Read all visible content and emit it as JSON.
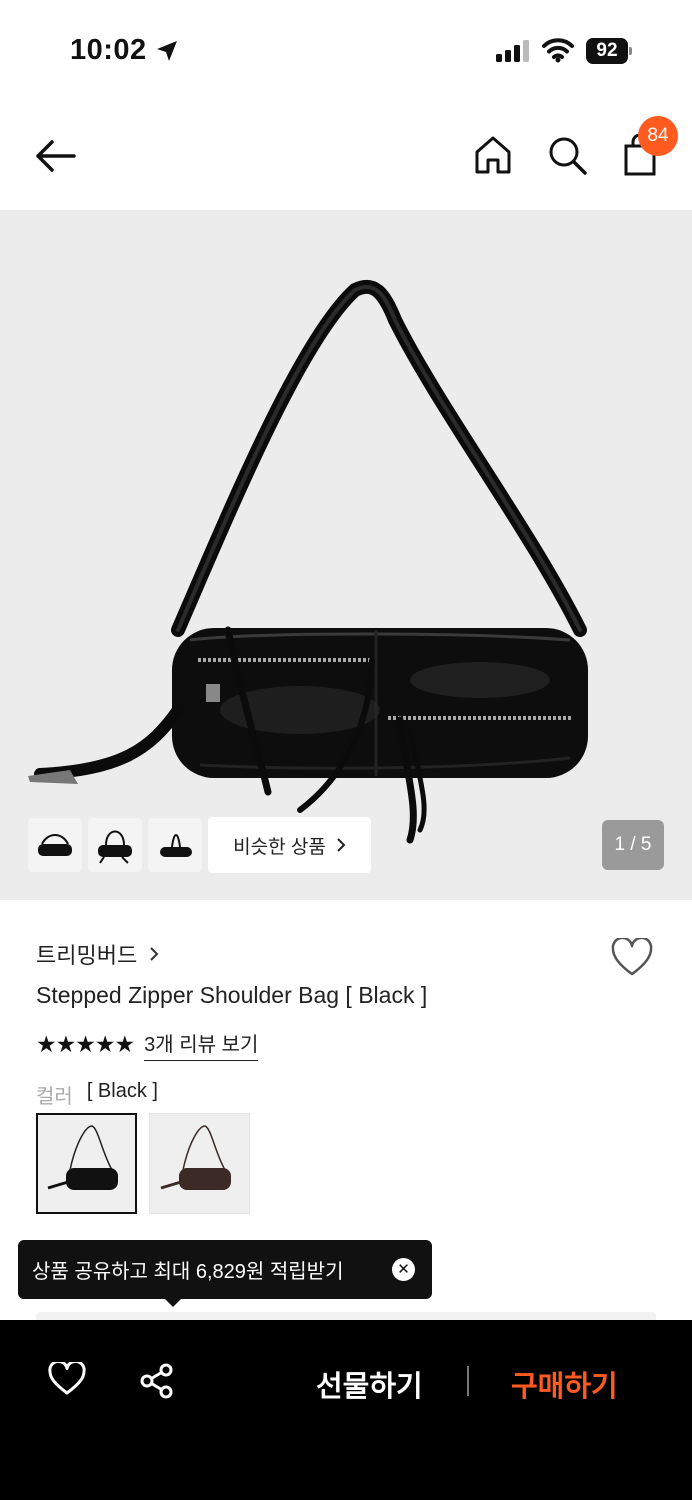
{
  "status_bar": {
    "time": "10:02",
    "battery": "92"
  },
  "nav": {
    "cart_count": "84"
  },
  "gallery": {
    "similar_label": "비슷한 상품",
    "page_counter": "1 / 5"
  },
  "product": {
    "brand": "트리밍버드",
    "title": "Stepped Zipper Shoulder Bag [ Black ]",
    "rating": 5,
    "stars": "★★★★★",
    "review_link": "3개 리뷰 보기",
    "color_label": "컬러",
    "color_value": "[ Black ]",
    "swatches": [
      "black",
      "brown"
    ]
  },
  "tooltip": {
    "text": "상품 공유하고 최대 6,829원 적립받기"
  },
  "bottom_bar": {
    "gift_label": "선물하기",
    "buy_label": "구매하기"
  },
  "colors": {
    "accent": "#ff5a1f",
    "hero_bg": "#ececec",
    "bar_bg": "#000000"
  },
  "icons": [
    "location-arrow-icon",
    "signal-icon",
    "wifi-icon",
    "battery-icon",
    "back-arrow-icon",
    "home-icon",
    "search-icon",
    "cart-icon",
    "chevron-right-icon",
    "heart-icon",
    "share-icon",
    "close-icon"
  ]
}
